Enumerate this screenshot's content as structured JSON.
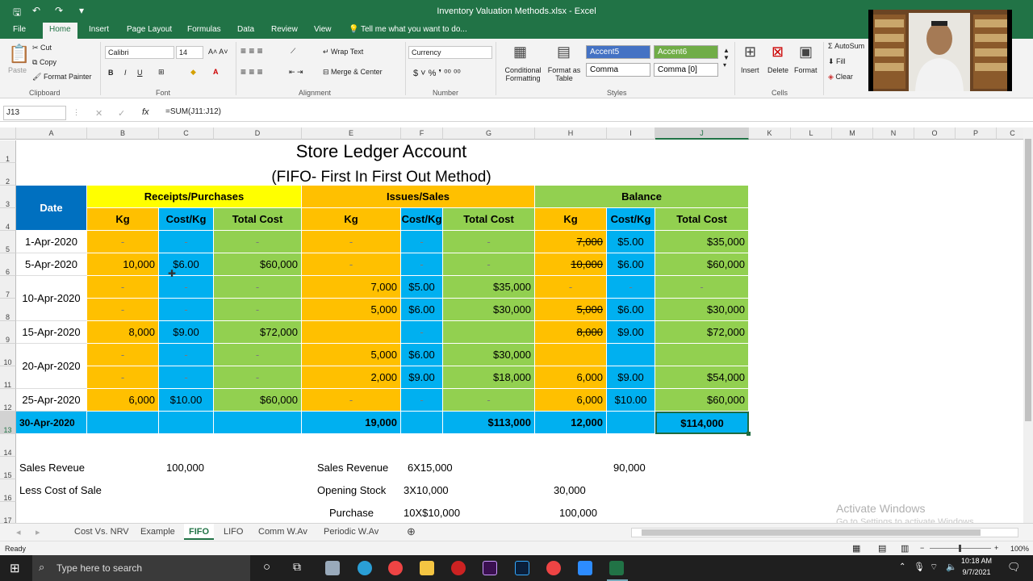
{
  "window": {
    "title": "Inventory Valuation Methods.xlsx - Excel"
  },
  "ribbon": {
    "tabs": [
      "File",
      "Home",
      "Insert",
      "Page Layout",
      "Formulas",
      "Data",
      "Review",
      "View"
    ],
    "tell_me": "Tell me what you want to do...",
    "clipboard": {
      "paste": "Paste",
      "cut": "Cut",
      "copy": "Copy",
      "format_painter": "Format Painter",
      "group": "Clipboard"
    },
    "font": {
      "name": "Calibri",
      "size": "14",
      "group": "Font"
    },
    "alignment": {
      "wrap": "Wrap Text",
      "merge": "Merge & Center",
      "group": "Alignment"
    },
    "number": {
      "format": "Currency",
      "group": "Number"
    },
    "styles": {
      "conditional": "Conditional Formatting",
      "format_as_table": "Format as Table",
      "accent5": "Accent5",
      "accent6": "Accent6",
      "comma": "Comma",
      "comma0": "Comma [0]",
      "group": "Styles"
    },
    "cells": {
      "insert": "Insert",
      "delete": "Delete",
      "format": "Format",
      "group": "Cells"
    },
    "editing": {
      "autosum": "AutoSum",
      "fill": "Fill",
      "clear": "Clear",
      "group": "Editing"
    }
  },
  "formula_bar": {
    "name_box": "J13",
    "formula": "=SUM(J11:J12)"
  },
  "columns": [
    "A",
    "B",
    "C",
    "D",
    "E",
    "F",
    "G",
    "H",
    "I",
    "J",
    "K",
    "L",
    "M",
    "N",
    "O",
    "P",
    "C"
  ],
  "rows": [
    "1",
    "2",
    "3",
    "4",
    "5",
    "6",
    "7",
    "8",
    "9",
    "10",
    "11",
    "12",
    "13",
    "14",
    "15",
    "16",
    "17"
  ],
  "sheet": {
    "title": "Store Ledger Account",
    "subtitle": "(FIFO- First In First Out Method)",
    "headers": {
      "date": "Date",
      "receipts": "Receipts/Purchases",
      "issues": "Issues/Sales",
      "balance": "Balance",
      "kg": "Kg",
      "cost_kg": "Cost/Kg",
      "total_cost": "Total Cost"
    },
    "dates": [
      "1-Apr-2020",
      "5-Apr-2020",
      "10-Apr-2020",
      "15-Apr-2020",
      "20-Apr-2020",
      "25-Apr-2020",
      "30-Apr-2020"
    ],
    "data_rows": [
      [
        "-",
        "-",
        "-",
        "-",
        "-",
        "-",
        "7,000",
        "$5.00",
        "$35,000"
      ],
      [
        "10,000",
        "$6.00",
        "$60,000",
        "-",
        "-",
        "-",
        "10,000",
        "$6.00",
        "$60,000"
      ],
      [
        "-",
        "-",
        "-",
        "7,000",
        "$5.00",
        "$35,000",
        "-",
        "-",
        "-"
      ],
      [
        "-",
        "-",
        "-",
        "5,000",
        "$6.00",
        "$30,000",
        "5,000",
        "$6.00",
        "$30,000"
      ],
      [
        "8,000",
        "$9.00",
        "$72,000",
        "",
        "-",
        "",
        "8,000",
        "$9.00",
        "$72,000"
      ],
      [
        "-",
        "-",
        "-",
        "5,000",
        "$6.00",
        "$30,000",
        "",
        "",
        ""
      ],
      [
        "-",
        "-",
        "-",
        "2,000",
        "$9.00",
        "$18,000",
        "6,000",
        "$9.00",
        "$54,000"
      ],
      [
        "6,000",
        "$10.00",
        "$60,000",
        "-",
        "-",
        "-",
        "6,000",
        "$10.00",
        "$60,000"
      ]
    ],
    "totals": {
      "issue_kg": "19,000",
      "issue_total": "$113,000",
      "balance_kg": "12,000",
      "balance_total": "$114,000"
    },
    "notes": {
      "sales_reveue": "Sales Reveue",
      "sales_reveue_val": "100,000",
      "less_cost": "Less Cost of Sale",
      "sales_revenue": "Sales Revenue",
      "sales_calc": "6X15,000",
      "sales_val": "90,000",
      "opening": "Opening Stock",
      "opening_calc": "3X10,000",
      "opening_val": "30,000",
      "purchase": "Purchase",
      "purchase_calc": "10X$10,000",
      "purchase_val": "100,000"
    }
  },
  "sheet_tabs": [
    "Cost Vs. NRV",
    "Example",
    "FIFO",
    "LIFO",
    "Comm W.Av",
    "Periodic W.Av"
  ],
  "status": {
    "ready": "Ready",
    "zoom": "100%"
  },
  "watermark": {
    "line1": "Activate Windows",
    "line2": "Go to Settings to activate Windows."
  },
  "taskbar": {
    "search": "Type here to search",
    "time": "10:18 AM",
    "date": "9/7/2021"
  }
}
